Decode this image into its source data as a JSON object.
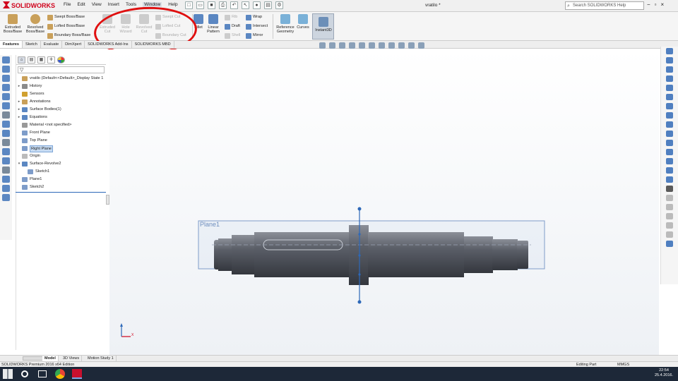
{
  "app": {
    "brand": "SOLIDWORKS",
    "document_title": "vratilo *"
  },
  "menu": [
    "File",
    "Edit",
    "View",
    "Insert",
    "Tools",
    "Window",
    "Help"
  ],
  "search": {
    "placeholder": "Search SOLIDWORKS Help"
  },
  "ribbon": {
    "extruded_boss": "Extruded Boss/Base",
    "revolved_boss": "Revolved Boss/Base",
    "swept_boss": "Swept Boss/Base",
    "lofted_boss": "Lofted Boss/Base",
    "boundary_boss": "Boundary Boss/Base",
    "extruded_cut": "Extruded Cut",
    "hole_wizard": "Hole Wizard",
    "revolved_cut": "Revolved Cut",
    "swept_cut": "Swept Cut",
    "lofted_cut": "Lofted Cut",
    "boundary_cut": "Boundary Cut",
    "fillet": "Fillet",
    "linear_pattern": "Linear Pattern",
    "rib": "Rib",
    "draft": "Draft",
    "shell": "Shell",
    "wrap": "Wrap",
    "intersect": "Intersect",
    "mirror": "Mirror",
    "reference_geometry": "Reference Geometry",
    "curves": "Curves",
    "instant3d": "Instant3D"
  },
  "command_tabs": [
    "Features",
    "Sketch",
    "Evaluate",
    "DimXpert",
    "SOLIDWORKS Add-Ins",
    "SOLIDWORKS MBD"
  ],
  "tree": {
    "root": "vratilo  (Default<<Default>_Display State 1",
    "items": [
      {
        "label": "History",
        "expand": "▸"
      },
      {
        "label": "Sensors",
        "expand": ""
      },
      {
        "label": "Annotations",
        "expand": "▸"
      },
      {
        "label": "Surface Bodies(1)",
        "expand": "▸"
      },
      {
        "label": "Equations",
        "expand": "▸"
      },
      {
        "label": "Material <not specified>",
        "expand": ""
      },
      {
        "label": "Front Plane",
        "expand": ""
      },
      {
        "label": "Top Plane",
        "expand": ""
      },
      {
        "label": "Right Plane",
        "expand": ""
      },
      {
        "label": "Origin",
        "expand": ""
      },
      {
        "label": "Surface-Revolve2",
        "expand": "▾"
      },
      {
        "label": "Sketch1",
        "expand": ""
      },
      {
        "label": "Plane1",
        "expand": ""
      },
      {
        "label": "Sketch2",
        "expand": ""
      }
    ]
  },
  "viewport": {
    "plane_label": "Plane1",
    "triad_x": "X"
  },
  "bottom_tabs": [
    "Model",
    "3D Views",
    "Motion Study 1"
  ],
  "status": {
    "left": "SOLIDWORKS Premium 2016 x64 Edition",
    "mode": "Editing Part",
    "units": "MMGS"
  },
  "taskbar": {
    "time": "22:54",
    "date": "25.4.2016."
  },
  "colors": {
    "annotation_circle": "#e01010",
    "selection": "#2d68b8",
    "brand": "#d0021b"
  }
}
